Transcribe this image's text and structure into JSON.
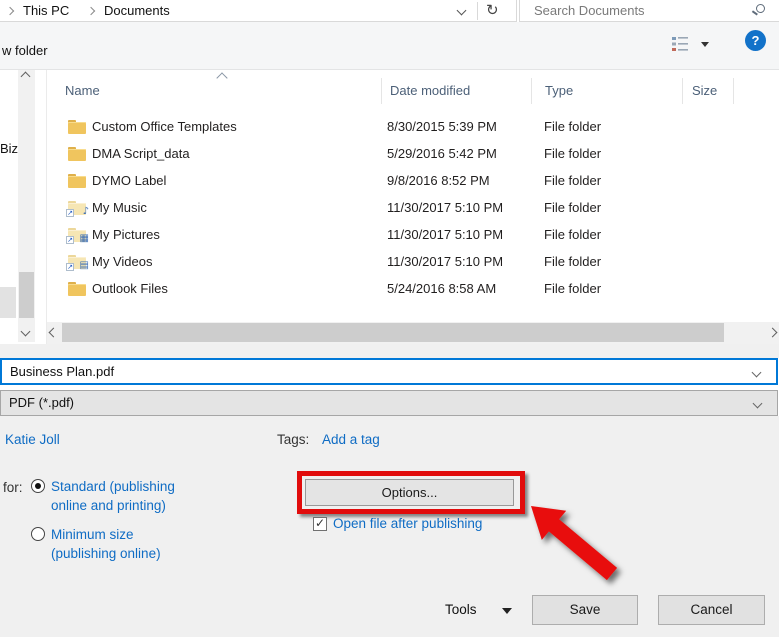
{
  "colors": {
    "accent_blue": "#0078d7",
    "link_blue": "#0f6cc4",
    "annotation_red": "#e10c0c",
    "help_blue": "#1272c9",
    "header_text": "#4c6078",
    "folder_yellow": "#f0c55e"
  },
  "address_bar": {
    "breadcrumb_items": [
      "This PC",
      "Documents"
    ]
  },
  "search_box": {
    "placeholder": "Search Documents"
  },
  "command_bar": {
    "new_folder_fragment": "w folder",
    "help_glyph": "?"
  },
  "navigation_pane": {
    "visible_item_fragment": "Biz"
  },
  "file_list": {
    "columns": [
      "Name",
      "Date modified",
      "Type",
      "Size"
    ],
    "sorted_column": "Name",
    "rows": [
      {
        "icon": "folder-icon",
        "name": "Custom Office Templates",
        "date_modified": "8/30/2015 5:39 PM",
        "type": "File folder",
        "size": ""
      },
      {
        "icon": "folder-icon",
        "name": "DMA Script_data",
        "date_modified": "5/29/2016 5:42 PM",
        "type": "File folder",
        "size": ""
      },
      {
        "icon": "folder-icon",
        "name": "DYMO Label",
        "date_modified": "9/8/2016 8:52 PM",
        "type": "File folder",
        "size": ""
      },
      {
        "icon": "folder-music-icon",
        "name": "My Music",
        "date_modified": "11/30/2017 5:10 PM",
        "type": "File folder",
        "size": ""
      },
      {
        "icon": "folder-pictures-icon",
        "name": "My Pictures",
        "date_modified": "11/30/2017 5:10 PM",
        "type": "File folder",
        "size": ""
      },
      {
        "icon": "folder-videos-icon",
        "name": "My Videos",
        "date_modified": "11/30/2017 5:10 PM",
        "type": "File folder",
        "size": ""
      },
      {
        "icon": "folder-icon",
        "name": "Outlook Files",
        "date_modified": "5/24/2016 8:58 AM",
        "type": "File folder",
        "size": ""
      }
    ]
  },
  "file_name_field": {
    "value": "Business Plan.pdf"
  },
  "save_as_type_field": {
    "value": "PDF (*.pdf)"
  },
  "details_pane": {
    "author": "Katie Joll",
    "tags_label": "Tags:",
    "add_tag_link": "Add a tag",
    "optimize_label_fragment": "for:",
    "radio_standard_line1": "Standard (publishing",
    "radio_standard_line2": "online and printing)",
    "radio_standard_selected": true,
    "radio_minimum_line1": "Minimum size",
    "radio_minimum_line2": "(publishing online)",
    "radio_minimum_selected": false,
    "options_button": "Options...",
    "open_after_checkbox_label": "Open file after publishing",
    "open_after_checked": true
  },
  "footer": {
    "tools_label": "Tools",
    "save_label": "Save",
    "cancel_label": "Cancel"
  }
}
